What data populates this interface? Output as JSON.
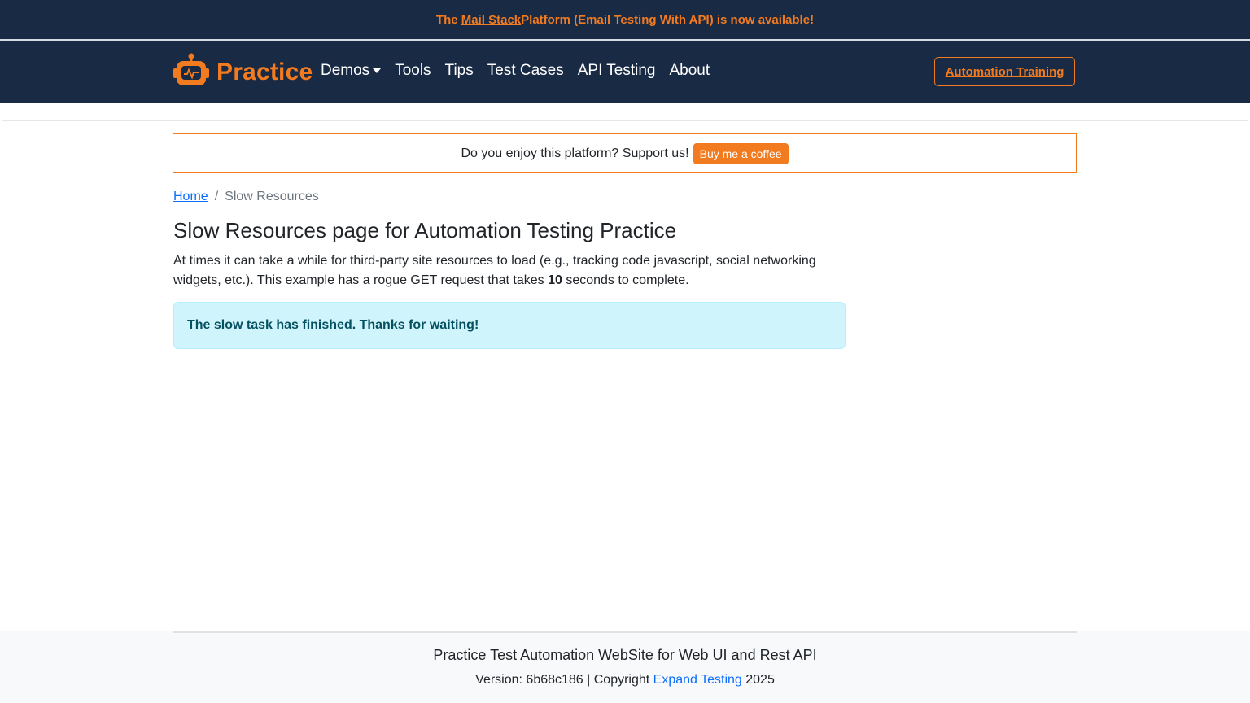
{
  "banner": {
    "prefix": "The ",
    "link": "Mail Stack",
    "suffix": " Platform (Email Testing With API) is now available!"
  },
  "navbar": {
    "brand": "Practice",
    "links": [
      "Demos",
      "Tools",
      "Tips",
      "Test Cases",
      "API Testing",
      "About"
    ],
    "cta": "Automation Training"
  },
  "support": {
    "text": "Do you enjoy this platform? Support us!",
    "button": "Buy me a coffee"
  },
  "breadcrumb": {
    "home": "Home",
    "separator": "/",
    "current": "Slow Resources"
  },
  "page": {
    "title": "Slow Resources page for Automation Testing Practice",
    "desc_before": "At times it can take a while for third-party site resources to load (e.g., tracking code javascript, social networking widgets, etc.). This example has a rogue GET request that takes ",
    "desc_bold": "10",
    "desc_after": " seconds to complete.",
    "alert": "The slow task has finished. Thanks for waiting!"
  },
  "footer": {
    "title": "Practice Test Automation WebSite for Web UI and Rest API",
    "version_prefix": "Version: 6b68c186 | Copyright ",
    "link": "Expand Testing",
    "year": " 2025"
  },
  "colors": {
    "navy": "#192a45",
    "accent": "#f27b20",
    "link": "#0d6efd",
    "alert_bg": "#cff4fc",
    "alert_text": "#055160"
  },
  "icons": {
    "brand_logo": "robot-icon",
    "dropdown": "caret-down-icon"
  }
}
